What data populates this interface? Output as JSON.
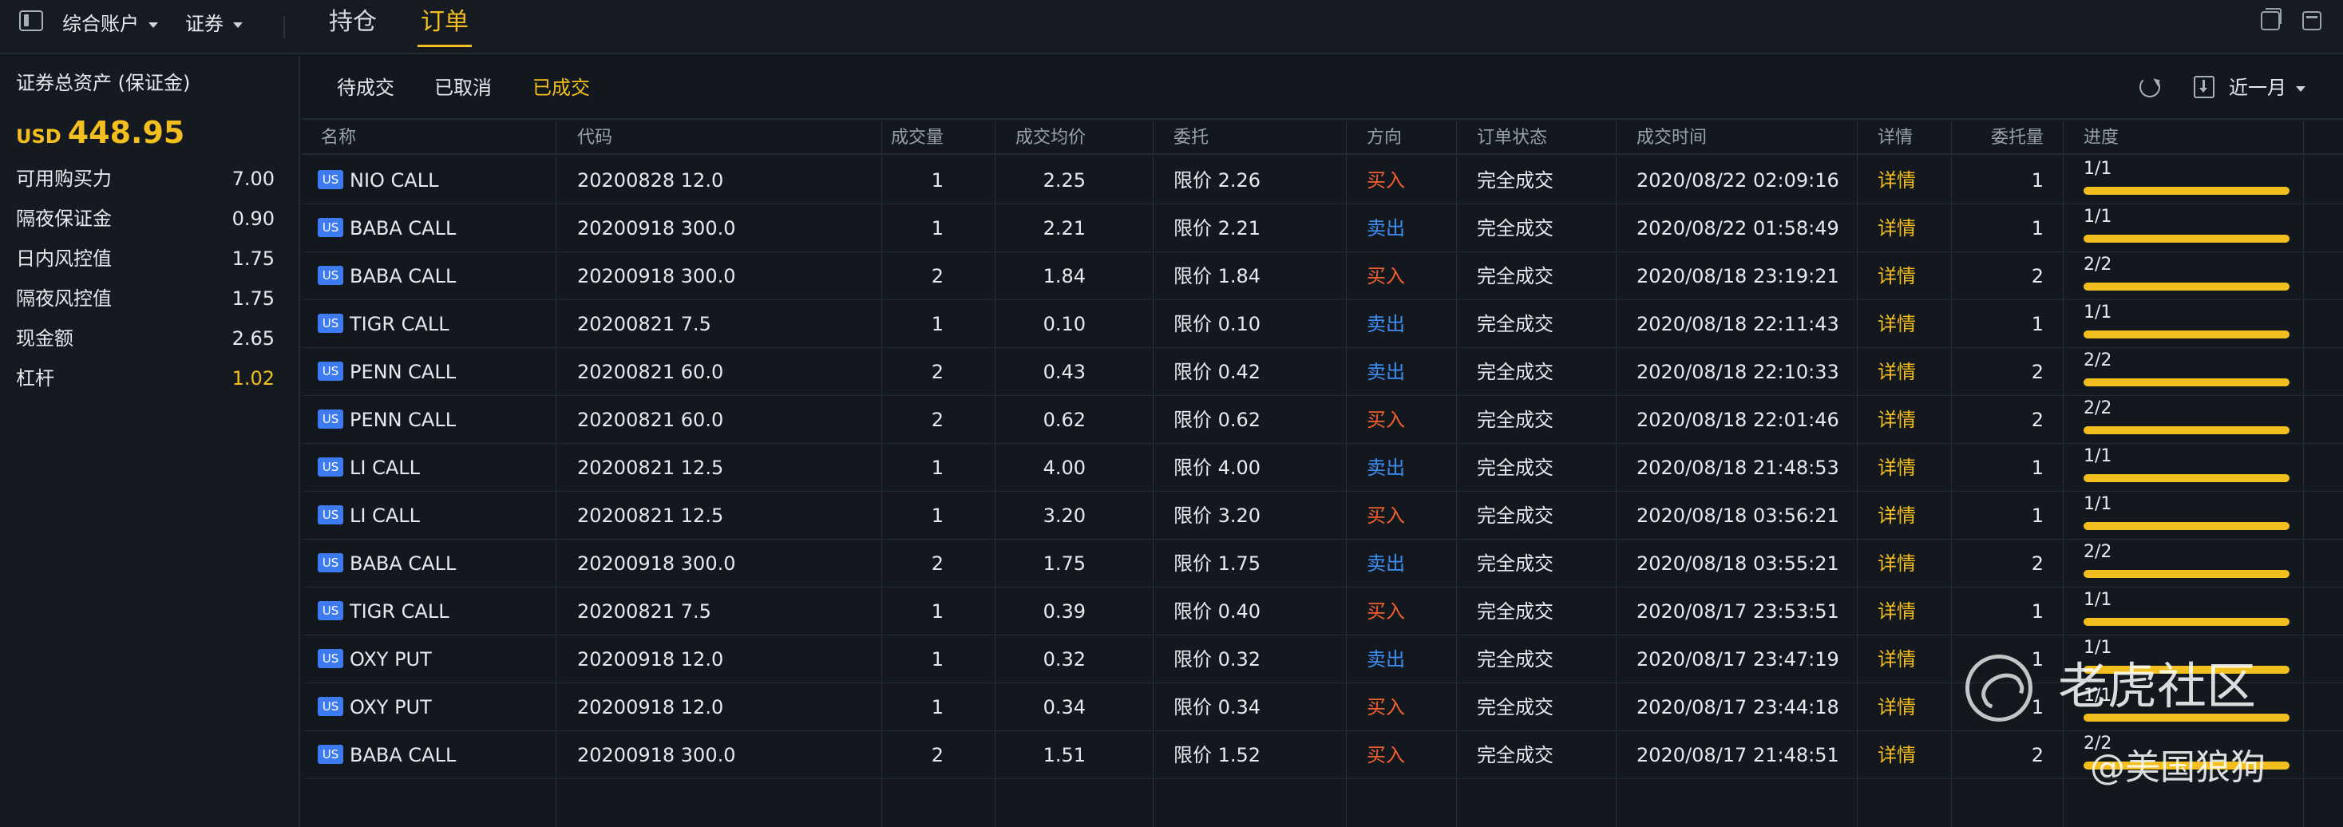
{
  "topbar": {
    "account_label": "综合账户",
    "market_label": "证券",
    "tabs": [
      {
        "label": "持仓",
        "active": false
      },
      {
        "label": "订单",
        "active": true
      }
    ]
  },
  "summary": {
    "title": "证券总资产 (保证金)",
    "currency": "USD",
    "total": "448.95",
    "metrics": [
      {
        "label": "可用购买力",
        "value": "7.00",
        "highlight": false
      },
      {
        "label": "隔夜保证金",
        "value": "0.90",
        "highlight": false
      },
      {
        "label": "日内风控值",
        "value": "1.75",
        "highlight": false
      },
      {
        "label": "隔夜风控值",
        "value": "1.75",
        "highlight": false
      },
      {
        "label": "现金额",
        "value": "2.65",
        "highlight": false
      },
      {
        "label": "杠杆",
        "value": "1.02",
        "highlight": true
      }
    ]
  },
  "orders": {
    "subtabs": [
      {
        "label": "待成交",
        "active": false
      },
      {
        "label": "已取消",
        "active": false
      },
      {
        "label": "已成交",
        "active": true
      }
    ],
    "range_label": "近一月",
    "columns": [
      "名称",
      "代码",
      "成交量",
      "成交均价",
      "委托",
      "方向",
      "订单状态",
      "成交时间",
      "详情",
      "委托量",
      "进度"
    ],
    "market_badge": "US",
    "rows": [
      {
        "name": "NIO CALL",
        "code": "20200828 12.0",
        "qty": "1",
        "avg_price": "2.25",
        "order": "限价 2.26",
        "side": "买入",
        "side_type": "buy",
        "status": "完全成交",
        "time": "2020/08/22 02:09:16",
        "detail": "详情",
        "order_qty": "1",
        "progress": "1/1",
        "progress_pct": 100
      },
      {
        "name": "BABA CALL",
        "code": "20200918 300.0",
        "qty": "1",
        "avg_price": "2.21",
        "order": "限价 2.21",
        "side": "卖出",
        "side_type": "sell",
        "status": "完全成交",
        "time": "2020/08/22 01:58:49",
        "detail": "详情",
        "order_qty": "1",
        "progress": "1/1",
        "progress_pct": 100
      },
      {
        "name": "BABA CALL",
        "code": "20200918 300.0",
        "qty": "2",
        "avg_price": "1.84",
        "order": "限价 1.84",
        "side": "买入",
        "side_type": "buy",
        "status": "完全成交",
        "time": "2020/08/18 23:19:21",
        "detail": "详情",
        "order_qty": "2",
        "progress": "2/2",
        "progress_pct": 100
      },
      {
        "name": "TIGR CALL",
        "code": "20200821 7.5",
        "qty": "1",
        "avg_price": "0.10",
        "order": "限价 0.10",
        "side": "卖出",
        "side_type": "sell",
        "status": "完全成交",
        "time": "2020/08/18 22:11:43",
        "detail": "详情",
        "order_qty": "1",
        "progress": "1/1",
        "progress_pct": 100
      },
      {
        "name": "PENN CALL",
        "code": "20200821 60.0",
        "qty": "2",
        "avg_price": "0.43",
        "order": "限价 0.42",
        "side": "卖出",
        "side_type": "sell",
        "status": "完全成交",
        "time": "2020/08/18 22:10:33",
        "detail": "详情",
        "order_qty": "2",
        "progress": "2/2",
        "progress_pct": 100
      },
      {
        "name": "PENN CALL",
        "code": "20200821 60.0",
        "qty": "2",
        "avg_price": "0.62",
        "order": "限价 0.62",
        "side": "买入",
        "side_type": "buy",
        "status": "完全成交",
        "time": "2020/08/18 22:01:46",
        "detail": "详情",
        "order_qty": "2",
        "progress": "2/2",
        "progress_pct": 100
      },
      {
        "name": "LI CALL",
        "code": "20200821 12.5",
        "qty": "1",
        "avg_price": "4.00",
        "order": "限价 4.00",
        "side": "卖出",
        "side_type": "sell",
        "status": "完全成交",
        "time": "2020/08/18 21:48:53",
        "detail": "详情",
        "order_qty": "1",
        "progress": "1/1",
        "progress_pct": 100
      },
      {
        "name": "LI CALL",
        "code": "20200821 12.5",
        "qty": "1",
        "avg_price": "3.20",
        "order": "限价 3.20",
        "side": "买入",
        "side_type": "buy",
        "status": "完全成交",
        "time": "2020/08/18 03:56:21",
        "detail": "详情",
        "order_qty": "1",
        "progress": "1/1",
        "progress_pct": 100
      },
      {
        "name": "BABA CALL",
        "code": "20200918 300.0",
        "qty": "2",
        "avg_price": "1.75",
        "order": "限价 1.75",
        "side": "卖出",
        "side_type": "sell",
        "status": "完全成交",
        "time": "2020/08/18 03:55:21",
        "detail": "详情",
        "order_qty": "2",
        "progress": "2/2",
        "progress_pct": 100
      },
      {
        "name": "TIGR CALL",
        "code": "20200821 7.5",
        "qty": "1",
        "avg_price": "0.39",
        "order": "限价 0.40",
        "side": "买入",
        "side_type": "buy",
        "status": "完全成交",
        "time": "2020/08/17 23:53:51",
        "detail": "详情",
        "order_qty": "1",
        "progress": "1/1",
        "progress_pct": 100
      },
      {
        "name": "OXY PUT",
        "code": "20200918 12.0",
        "qty": "1",
        "avg_price": "0.32",
        "order": "限价 0.32",
        "side": "卖出",
        "side_type": "sell",
        "status": "完全成交",
        "time": "2020/08/17 23:47:19",
        "detail": "详情",
        "order_qty": "1",
        "progress": "1/1",
        "progress_pct": 100
      },
      {
        "name": "OXY PUT",
        "code": "20200918 12.0",
        "qty": "1",
        "avg_price": "0.34",
        "order": "限价 0.34",
        "side": "买入",
        "side_type": "buy",
        "status": "完全成交",
        "time": "2020/08/17 23:44:18",
        "detail": "详情",
        "order_qty": "1",
        "progress": "1/1",
        "progress_pct": 100
      },
      {
        "name": "BABA CALL",
        "code": "20200918 300.0",
        "qty": "2",
        "avg_price": "1.51",
        "order": "限价 1.52",
        "side": "买入",
        "side_type": "buy",
        "status": "完全成交",
        "time": "2020/08/17 21:48:51",
        "detail": "详情",
        "order_qty": "2",
        "progress": "2/2",
        "progress_pct": 100
      }
    ]
  },
  "watermark": {
    "text": "老虎社区",
    "author": "@美国狼狗"
  },
  "colors": {
    "accent": "#f3bf1f",
    "buy": "#f0602f",
    "sell": "#3d8ef6",
    "badge": "#3e7bf0"
  },
  "icons": [
    "panel-toggle-icon",
    "caret-down-icon",
    "refresh-icon",
    "export-icon",
    "restore-window-icon",
    "maximize-window-icon"
  ]
}
